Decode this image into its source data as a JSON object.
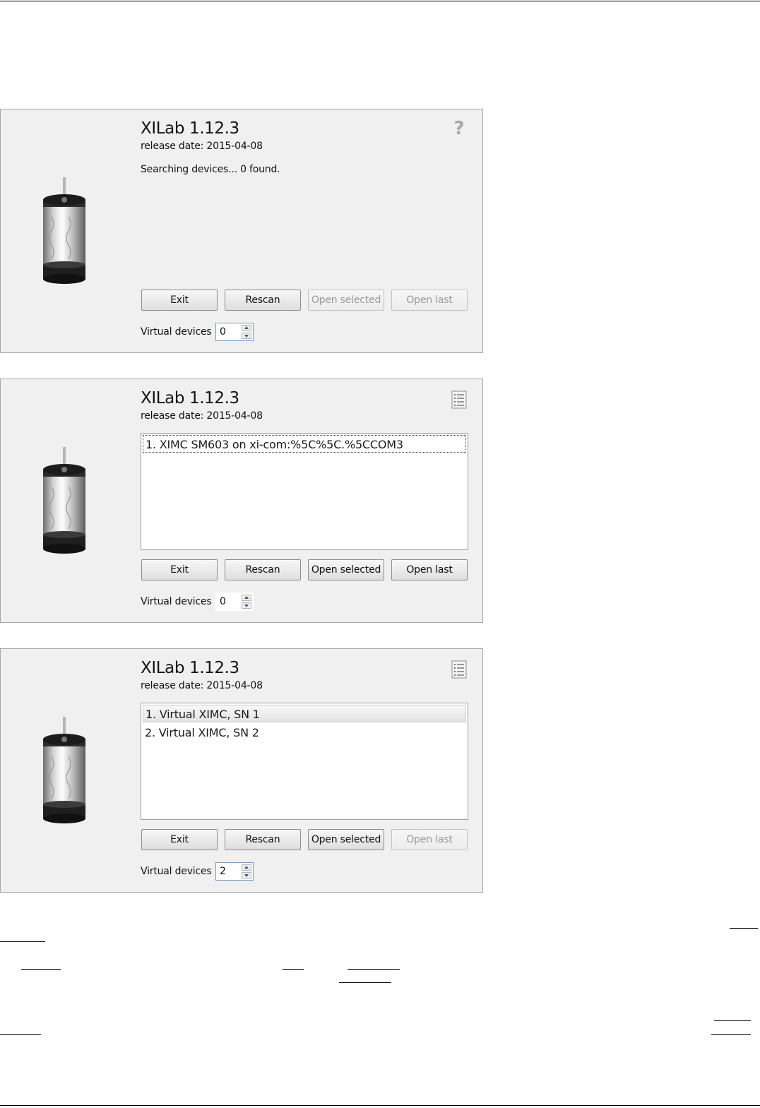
{
  "dialogs": [
    {
      "title": "XILab 1.12.3",
      "release": "release date: 2015-04-08",
      "status": "Searching devices... 0 found.",
      "corner_icon": "help-icon",
      "devices": [],
      "buttons": {
        "exit": "Exit",
        "rescan": "Rescan",
        "open_selected": "Open selected",
        "open_last": "Open last"
      },
      "open_selected_enabled": false,
      "open_last_enabled": false,
      "virtual_devices_label": "Virtual devices",
      "virtual_devices_value": "0"
    },
    {
      "title": "XILab 1.12.3",
      "release": "release date: 2015-04-08",
      "status": "",
      "corner_icon": "list-icon",
      "devices": [
        "1. XIMC SM603 on xi-com:%5C%5C.%5CCOM3"
      ],
      "buttons": {
        "exit": "Exit",
        "rescan": "Rescan",
        "open_selected": "Open selected",
        "open_last": "Open last"
      },
      "open_selected_enabled": true,
      "open_last_enabled": true,
      "virtual_devices_label": "Virtual devices",
      "virtual_devices_value": "0"
    },
    {
      "title": "XILab 1.12.3",
      "release": "release date: 2015-04-08",
      "status": "",
      "corner_icon": "list-icon",
      "devices": [
        "1. Virtual XIMC, SN 1",
        "2. Virtual XIMC, SN 2"
      ],
      "buttons": {
        "exit": "Exit",
        "rescan": "Rescan",
        "open_selected": "Open selected",
        "open_last": "Open last"
      },
      "open_selected_enabled": true,
      "open_last_enabled": false,
      "virtual_devices_label": "Virtual devices",
      "virtual_devices_value": "2"
    }
  ],
  "colors": {
    "dialog_bg": "#f0f0f0",
    "disabled_text": "#9a9a9a",
    "spin_focus_border": "#7a9cc6"
  }
}
